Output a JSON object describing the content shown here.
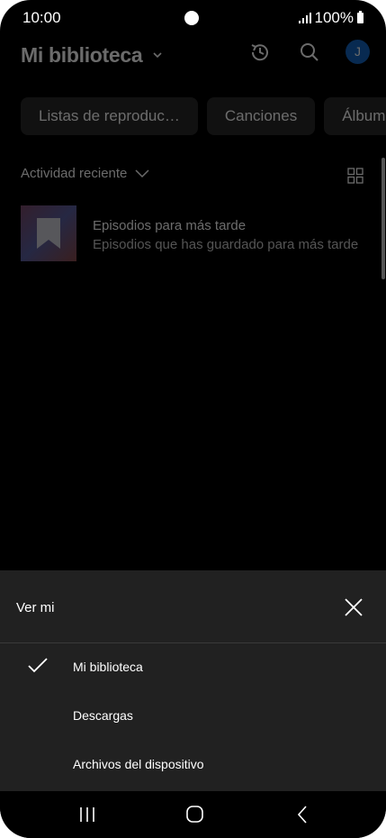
{
  "status": {
    "time": "10:00",
    "battery": "100%"
  },
  "header": {
    "title": "Mi biblioteca",
    "avatar_letter": "J"
  },
  "chips": [
    {
      "label": "Listas de reproduc…"
    },
    {
      "label": "Canciones"
    },
    {
      "label": "Álbum"
    }
  ],
  "sort": {
    "label": "Actividad reciente"
  },
  "items": [
    {
      "title": "Episodios para más tarde",
      "subtitle": "Episodios que has guardado para más tarde"
    }
  ],
  "sheet": {
    "title": "Ver mi",
    "options": [
      {
        "label": "Mi biblioteca",
        "selected": true
      },
      {
        "label": "Descargas",
        "selected": false
      },
      {
        "label": "Archivos del dispositivo",
        "selected": false
      }
    ]
  },
  "colors": {
    "background": "#000000",
    "sheet": "#212121",
    "avatar": "#1565c0"
  },
  "icons": [
    "history-icon",
    "search-icon",
    "grid-icon",
    "bookmark-icon",
    "close-icon",
    "check-icon",
    "chevron-down-icon"
  ]
}
